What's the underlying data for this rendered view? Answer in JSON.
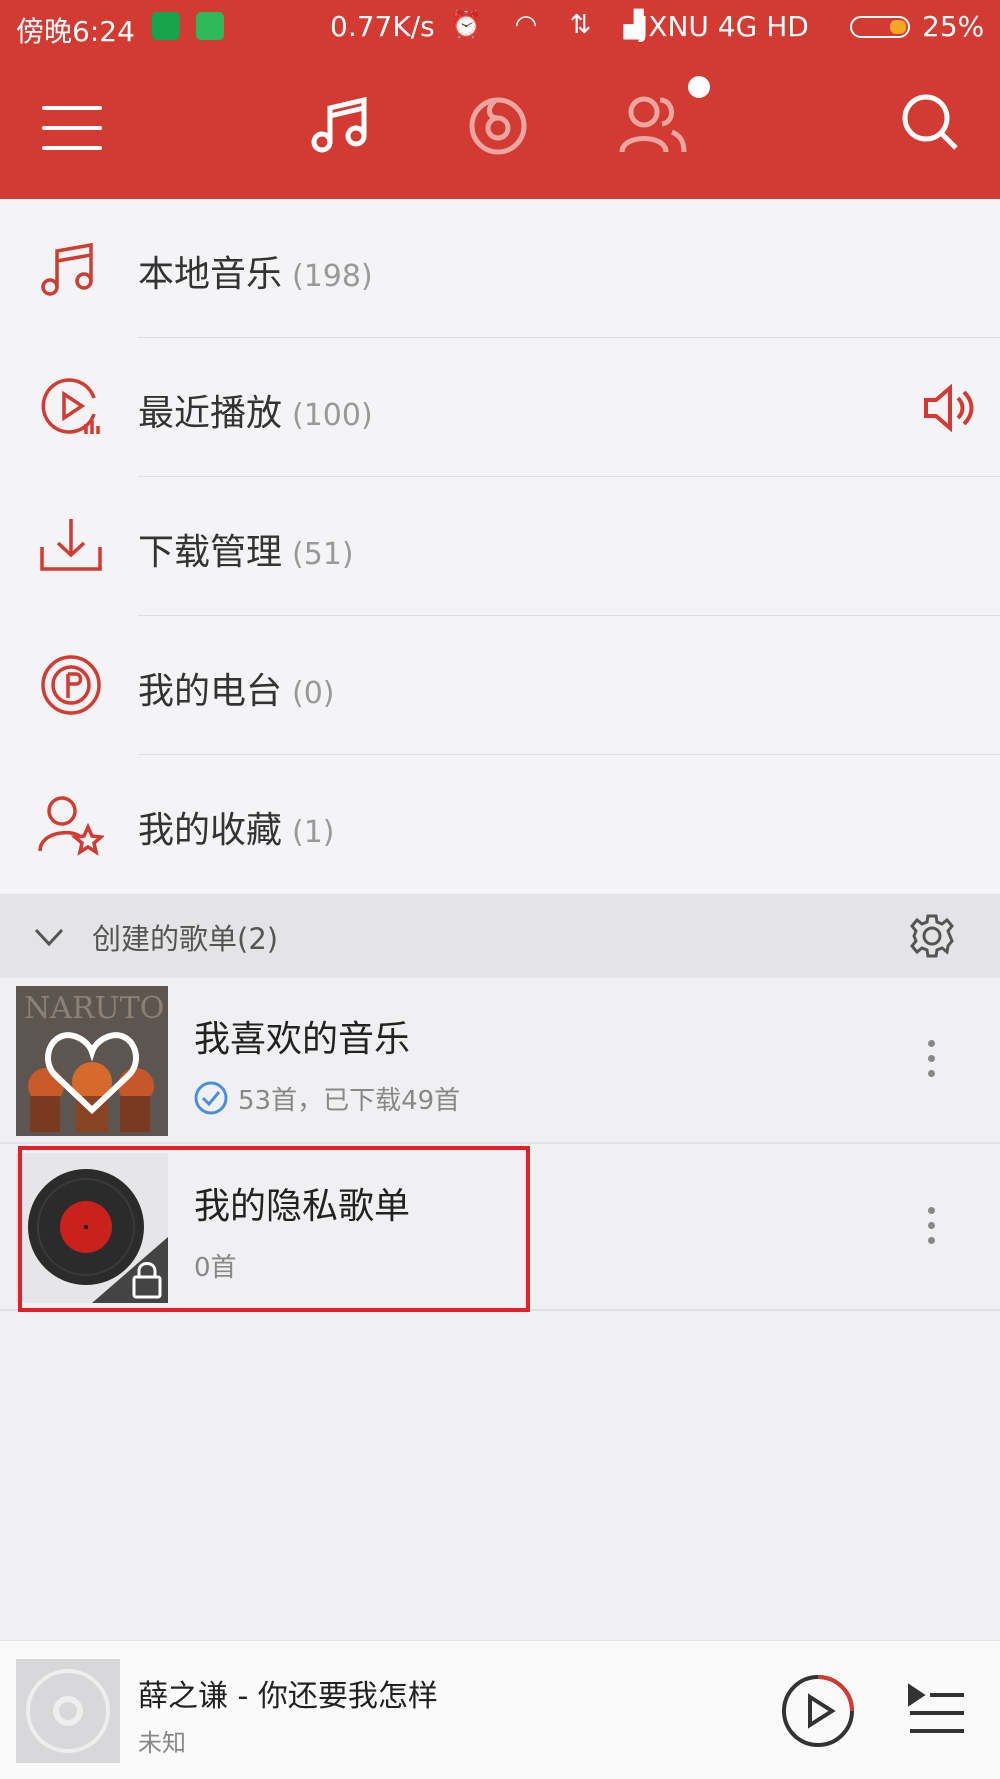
{
  "status_bar": {
    "time": "傍晚6:24",
    "speed": "0.77K/s",
    "network": "JXNU 4G HD",
    "battery": "25%"
  },
  "header": {
    "active_tab": "music",
    "notification_dot": true
  },
  "menu": [
    {
      "label": "本地音乐",
      "count": "(198)",
      "icon": "music-note-icon"
    },
    {
      "label": "最近播放",
      "count": "(100)",
      "icon": "recent-play-icon",
      "playing": true
    },
    {
      "label": "下载管理",
      "count": "(51)",
      "icon": "download-icon"
    },
    {
      "label": "我的电台",
      "count": "(0)",
      "icon": "radio-icon"
    },
    {
      "label": "我的收藏",
      "count": "(1)",
      "icon": "favorite-user-icon"
    }
  ],
  "section": {
    "label": "创建的歌单(2)"
  },
  "playlists": [
    {
      "title": "我喜欢的音乐",
      "subtitle": "53首，已下载49首",
      "downloaded": true,
      "cover_text": "NARUTO"
    },
    {
      "title": "我的隐私歌单",
      "subtitle": "0首",
      "locked": true
    }
  ],
  "now_playing": {
    "title": "薛之谦 - 你还要我怎样",
    "artist": "未知"
  },
  "colors": {
    "brand_red": "#d33a31",
    "highlight_red": "#e5202a"
  }
}
